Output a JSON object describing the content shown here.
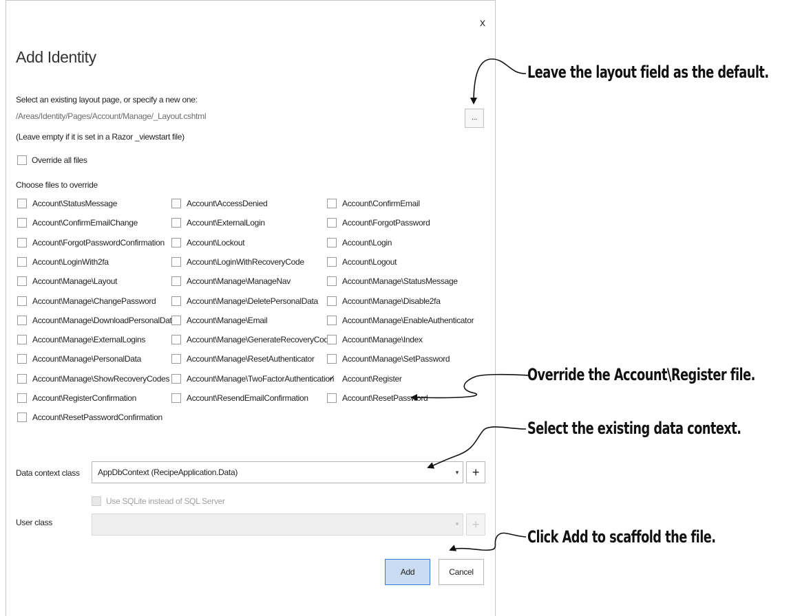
{
  "dialog": {
    "close_label": "x",
    "title": "Add Identity",
    "layout_label": "Select an existing layout page, or specify a new one:",
    "layout_value": "/Areas/Identity/Pages/Account/Manage/_Layout.cshtml",
    "browse_label": "...",
    "layout_hint": "(Leave empty if it is set in a Razor _viewstart file)",
    "override_all_label": "Override all files",
    "choose_label": "Choose files to override",
    "files": [
      {
        "label": "Account\\StatusMessage",
        "checked": false
      },
      {
        "label": "Account\\AccessDenied",
        "checked": false
      },
      {
        "label": "Account\\ConfirmEmail",
        "checked": false
      },
      {
        "label": "Account\\ConfirmEmailChange",
        "checked": false
      },
      {
        "label": "Account\\ExternalLogin",
        "checked": false
      },
      {
        "label": "Account\\ForgotPassword",
        "checked": false
      },
      {
        "label": "Account\\ForgotPasswordConfirmation",
        "checked": false
      },
      {
        "label": "Account\\Lockout",
        "checked": false
      },
      {
        "label": "Account\\Login",
        "checked": false
      },
      {
        "label": "Account\\LoginWith2fa",
        "checked": false
      },
      {
        "label": "Account\\LoginWithRecoveryCode",
        "checked": false
      },
      {
        "label": "Account\\Logout",
        "checked": false
      },
      {
        "label": "Account\\Manage\\Layout",
        "checked": false
      },
      {
        "label": "Account\\Manage\\ManageNav",
        "checked": false
      },
      {
        "label": "Account\\Manage\\StatusMessage",
        "checked": false
      },
      {
        "label": "Account\\Manage\\ChangePassword",
        "checked": false
      },
      {
        "label": "Account\\Manage\\DeletePersonalData",
        "checked": false
      },
      {
        "label": "Account\\Manage\\Disable2fa",
        "checked": false
      },
      {
        "label": "Account\\Manage\\DownloadPersonalData",
        "checked": false
      },
      {
        "label": "Account\\Manage\\Email",
        "checked": false
      },
      {
        "label": "Account\\Manage\\EnableAuthenticator",
        "checked": false
      },
      {
        "label": "Account\\Manage\\ExternalLogins",
        "checked": false
      },
      {
        "label": "Account\\Manage\\GenerateRecoveryCodes",
        "checked": false
      },
      {
        "label": "Account\\Manage\\Index",
        "checked": false
      },
      {
        "label": "Account\\Manage\\PersonalData",
        "checked": false
      },
      {
        "label": "Account\\Manage\\ResetAuthenticator",
        "checked": false
      },
      {
        "label": "Account\\Manage\\SetPassword",
        "checked": false
      },
      {
        "label": "Account\\Manage\\ShowRecoveryCodes",
        "checked": false
      },
      {
        "label": "Account\\Manage\\TwoFactorAuthentication",
        "checked": false
      },
      {
        "label": "Account\\Register",
        "checked": true
      },
      {
        "label": "Account\\RegisterConfirmation",
        "checked": false
      },
      {
        "label": "Account\\ResendEmailConfirmation",
        "checked": false
      },
      {
        "label": "Account\\ResetPassword",
        "checked": false
      },
      {
        "label": "Account\\ResetPasswordConfirmation",
        "checked": false
      }
    ],
    "data_context_label": "Data context class",
    "data_context_value": "AppDbContext (RecipeApplication.Data)",
    "data_context_add": "+",
    "sqlite_label": "Use SQLite instead of SQL Server",
    "user_class_label": "User class",
    "user_class_value": "",
    "user_class_add": "+",
    "add_button": "Add",
    "cancel_button": "Cancel",
    "dropdown_icon": "chevron-down-icon",
    "check_glyph": "✓"
  },
  "annotations": {
    "layout": "Leave the layout field as the default.",
    "register": "Override the Account\\Register file.",
    "context": "Select the existing data context.",
    "add": "Click Add to scaffold the file."
  },
  "colors": {
    "primary_button_bg": "#c9dcf2",
    "primary_button_border": "#3b7bd4",
    "disabled_text": "#a0a0a0"
  }
}
